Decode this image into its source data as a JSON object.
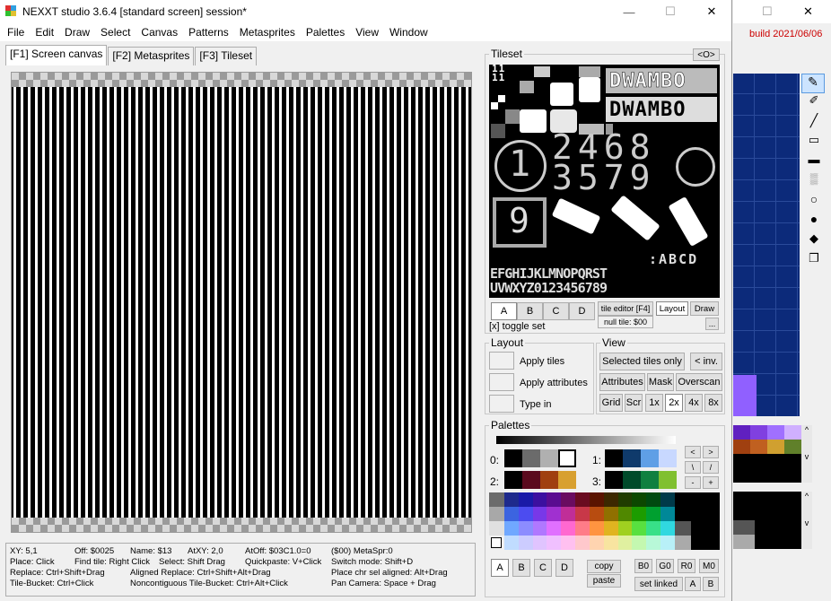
{
  "window": {
    "title": "NEXXT studio 3.6.4  [standard screen] session*",
    "minimize": "—",
    "maximize": "☐",
    "close": "✕"
  },
  "menu": [
    "File",
    "Edit",
    "Draw",
    "Select",
    "Canvas",
    "Patterns",
    "Metasprites",
    "Palettes",
    "View",
    "Window"
  ],
  "tabs": [
    "[F1] Screen canvas",
    "[F2] Metasprites",
    "[F3] Tileset"
  ],
  "status": {
    "row1": [
      "XY: 5,1",
      "Off: $0025",
      "Name: $13",
      "AtXY: 2,0",
      "AtOff: $03C1.0=0",
      "($00)  MetaSpr:0"
    ],
    "row2": [
      "Place: Click",
      "Find tile: Right Click",
      "Select: Shift Drag",
      "Quickpaste: V+Click",
      "Switch mode: Shift+D"
    ],
    "row3": [
      "Replace: Ctrl+Shift+Drag",
      "Aligned Replace: Ctrl+Shift+Alt+Drag",
      "Place chr sel aligned: Alt+Drag"
    ],
    "row4": [
      "Tile-Bucket: Ctrl+Click",
      "Noncontiguous Tile-Bucket: Ctrl+Alt+Click",
      "Pan Camera: Space + Drag"
    ]
  },
  "tileset": {
    "label": "Tileset",
    "collapse": "<O>",
    "text_dwambo": "DWAMBO",
    "digits_top": "2468",
    "digits_bot": "3579",
    "one": "1",
    "nine": "9",
    "tiny": "11 11",
    "row_abcd": ":ABCD",
    "row_alpha1": "EFGHIJKLMNOPQRST",
    "row_alpha2": "UVWXYZ0123456789",
    "banks": [
      "A",
      "B",
      "C",
      "D"
    ],
    "toggle": "[x] toggle set",
    "tile_editor": "tile editor [F4]",
    "layout": "Layout",
    "draw": "Draw",
    "null_tile": "null tile: $00",
    "more": "..."
  },
  "layout": {
    "label": "Layout",
    "apply_tiles": "Apply tiles",
    "apply_attributes": "Apply attributes",
    "type_in": "Type in"
  },
  "view": {
    "label": "View",
    "selected_tiles_only": "Selected tiles only",
    "inv": "< inv.",
    "attributes": "Attributes",
    "mask": "Mask",
    "overscan": "Overscan",
    "grid": "Grid",
    "scr": "Scr",
    "x1": "1x",
    "x2": "2x",
    "x4": "4x",
    "x8": "8x"
  },
  "palettes": {
    "label": "Palettes",
    "p0": "0:",
    "p1": "1:",
    "p2": "2:",
    "p3": "3:",
    "nav": [
      "<",
      ">",
      "\\",
      "/",
      "-",
      "+"
    ],
    "banks": [
      "A",
      "B",
      "C",
      "D"
    ],
    "copy": "copy",
    "paste": "paste",
    "b0": "B0",
    "g0": "G0",
    "r0": "R0",
    "m0": "M0",
    "set_linked": "set linked",
    "a": "A",
    "b": "B",
    "sub0": [
      "#000000",
      "#6b6b6b",
      "#b0b0b0",
      "#ffffff"
    ],
    "sub1": [
      "#000000",
      "#0f3a6b",
      "#5f9fe6",
      "#c8d8ff"
    ],
    "sub2": [
      "#000000",
      "#5a0a1e",
      "#a04010",
      "#d8a030"
    ],
    "sub3": [
      "#000000",
      "#004a2a",
      "#108040",
      "#80c030"
    ],
    "master": [
      "#1e2a8c",
      "#1a1aa8",
      "#3c10a0",
      "#5a0c90",
      "#6a0c60",
      "#6a0c20",
      "#5a1400",
      "#3c2800",
      "#203c00",
      "#0c4800",
      "#004a10",
      "#003a4a",
      "#3c64e0",
      "#4c4cf0",
      "#7838e8",
      "#a030d0",
      "#c02e98",
      "#c83848",
      "#b84c10",
      "#907000",
      "#508800",
      "#1c9c00",
      "#00a030",
      "#008898",
      "#70a8ff",
      "#8c8cff",
      "#b078ff",
      "#e070ff",
      "#ff68d0",
      "#ff7c88",
      "#ff9440",
      "#e0b420",
      "#a0d020",
      "#58e040",
      "#38e088",
      "#30d8e0",
      "#c0dcff",
      "#ccccff",
      "#e0c4ff",
      "#f0c0ff",
      "#ffc0f0",
      "#ffc8cc",
      "#ffd4b0",
      "#f8e4a0",
      "#e0f0a0",
      "#c4f8b0",
      "#b8f8d8",
      "#b8f0f8"
    ]
  },
  "right_panel": {
    "build": "build 2021/06/06",
    "max": "☐",
    "close": "✕"
  },
  "colors": {
    "accent_red": "#cc0000",
    "canvas_bg": "#000000"
  }
}
